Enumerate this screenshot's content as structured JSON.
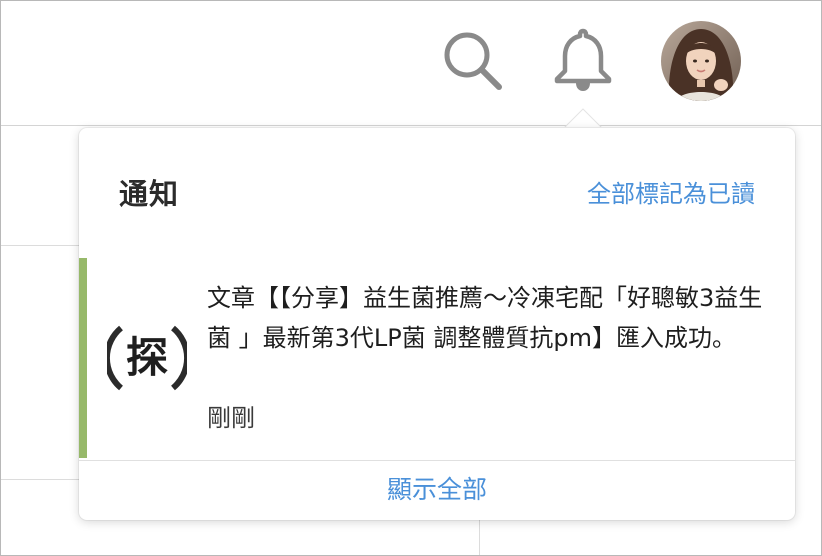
{
  "header": {
    "search_icon": "search-icon",
    "bell_icon": "bell-icon",
    "avatar_icon": "user-avatar"
  },
  "notifications_panel": {
    "title": "通知",
    "mark_all_read": "全部標記為已讀",
    "items": [
      {
        "icon": "tan-character-avatar",
        "icon_char": "探",
        "message": "文章【【分享】益生菌推薦～冷凍宅配「好聰敏3益生菌 」最新第3代LP菌 調整體質抗pm】匯入成功。",
        "time": "剛剛",
        "unread": true
      }
    ],
    "show_all": "顯示全部"
  },
  "colors": {
    "accent_link": "#4a90d9",
    "unread_indicator": "#97b96a",
    "icon_gray": "#8a8a8a"
  }
}
